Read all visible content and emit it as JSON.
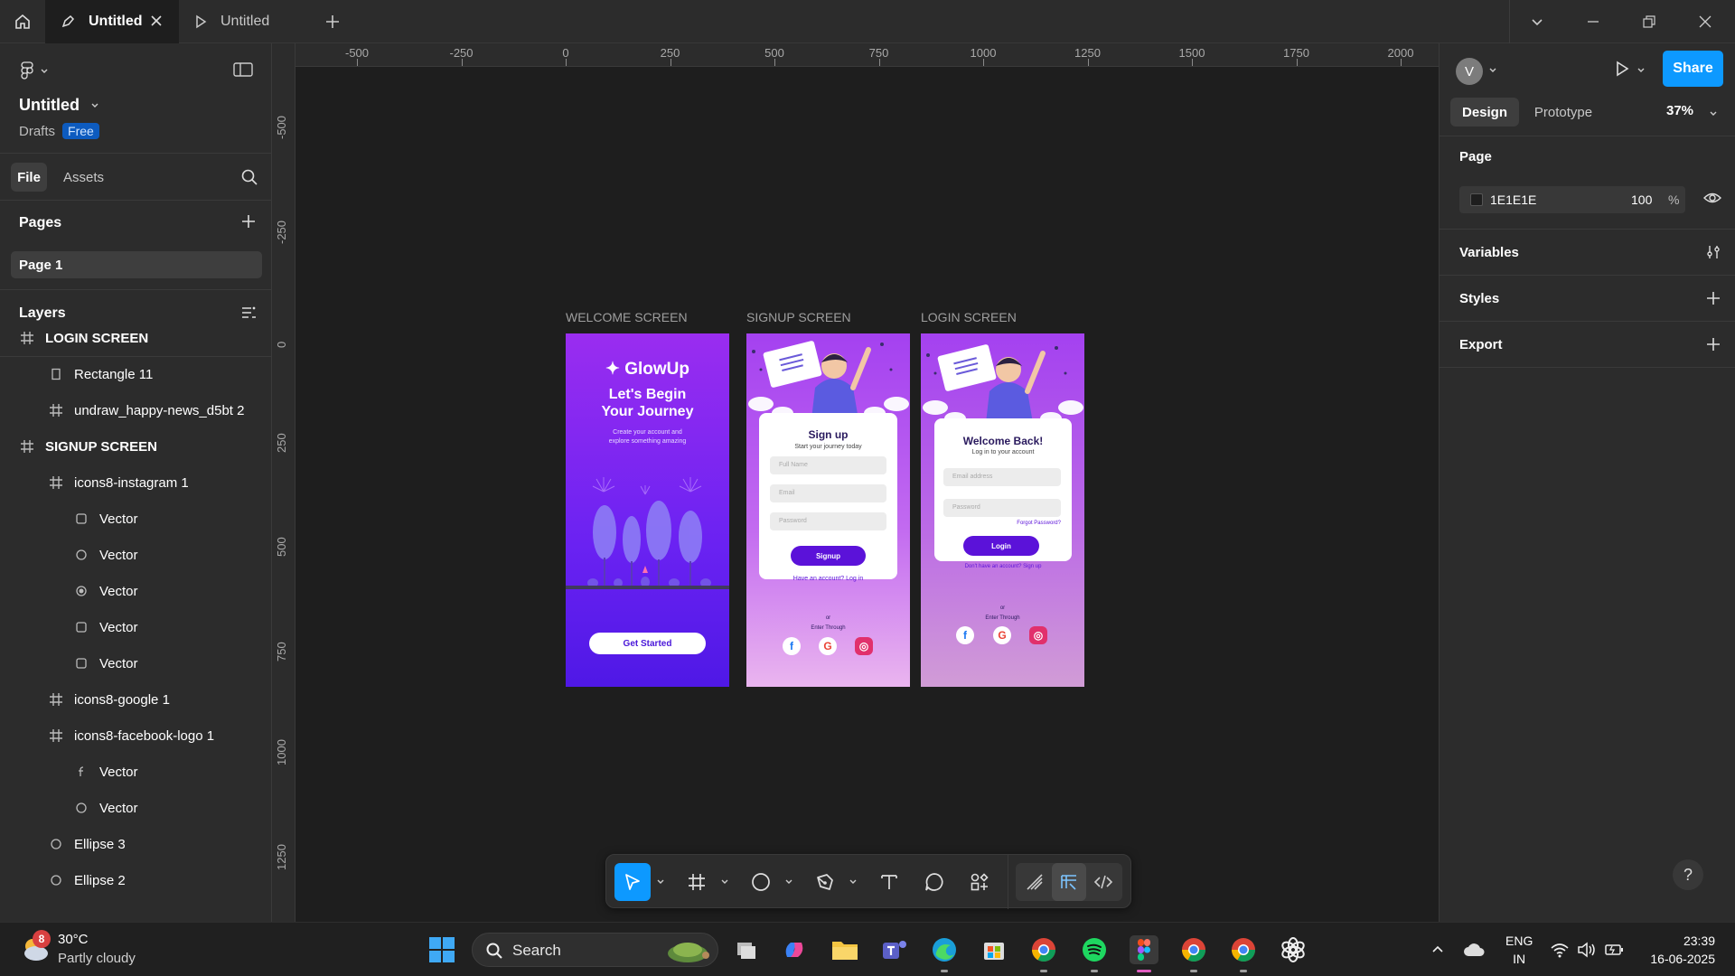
{
  "titlebar": {
    "tabs": [
      {
        "label": "Untitled",
        "kind": "design-file",
        "active": true
      },
      {
        "label": "Untitled",
        "kind": "prototype",
        "active": false
      }
    ]
  },
  "left_panel": {
    "file_title": "Untitled",
    "drafts_label": "Drafts",
    "plan_badge": "Free",
    "tabs": [
      "File",
      "Assets"
    ],
    "pages_heading": "Pages",
    "pages": [
      "Page 1"
    ],
    "layers_heading": "Layers",
    "layers": [
      {
        "name": "LOGIN SCREEN",
        "icon": "frame-icon",
        "level": 0
      },
      {
        "name": "Rectangle 11",
        "icon": "rectangle-icon",
        "level": 1
      },
      {
        "name": "undraw_happy-news_d5bt 2",
        "icon": "frame-icon",
        "level": 1
      },
      {
        "name": "SIGNUP SCREEN",
        "icon": "frame-icon",
        "level": 0
      },
      {
        "name": "icons8-instagram 1",
        "icon": "frame-icon",
        "level": 1
      },
      {
        "name": "Vector",
        "icon": "vector-square-icon",
        "level": 2
      },
      {
        "name": "Vector",
        "icon": "vector-circle-icon",
        "level": 2
      },
      {
        "name": "Vector",
        "icon": "vector-dot-icon",
        "level": 2
      },
      {
        "name": "Vector",
        "icon": "vector-square-icon",
        "level": 2
      },
      {
        "name": "Vector",
        "icon": "vector-square-icon",
        "level": 2
      },
      {
        "name": "icons8-google 1",
        "icon": "frame-icon",
        "level": 1
      },
      {
        "name": "icons8-facebook-logo 1",
        "icon": "frame-icon",
        "level": 1
      },
      {
        "name": "Vector",
        "icon": "vector-f-icon",
        "level": 2
      },
      {
        "name": "Vector",
        "icon": "vector-circle-icon",
        "level": 2
      },
      {
        "name": "Ellipse 3",
        "icon": "ellipse-icon",
        "level": 1
      },
      {
        "name": "Ellipse 2",
        "icon": "ellipse-icon",
        "level": 1
      }
    ]
  },
  "rulers": {
    "top": [
      "-500",
      "-250",
      "0",
      "250",
      "500",
      "750",
      "1000",
      "1250",
      "1500",
      "1750",
      "2000"
    ],
    "left": [
      "-500",
      "-250",
      "0",
      "250",
      "500",
      "750",
      "1000",
      "1250"
    ]
  },
  "canvas": {
    "welcome": {
      "label": "WELCOME SCREEN",
      "logo": "✦ GlowUp",
      "heading_line1": "Let's Begin",
      "heading_line2": "Your Journey",
      "subtext_line1": "Create your account and",
      "subtext_line2": "explore something amazing",
      "button": "Get Started"
    },
    "signup": {
      "label": "SIGNUP SCREEN",
      "title": "Sign up",
      "subtitle": "Start your journey today",
      "fields": [
        "Full Name",
        "Email",
        "Password"
      ],
      "button": "Signup",
      "link": "Have an account? Log in",
      "or_text": "or",
      "enter_through": "Enter Through"
    },
    "login": {
      "label": "LOGIN SCREEN",
      "title": "Welcome Back!",
      "subtitle": "Log in to your account",
      "fields": [
        "Email address",
        "Password"
      ],
      "forgot": "Forgot Password?",
      "button": "Login",
      "link": "Don't have an account? Sign up",
      "or_text": "or",
      "enter_through": "Enter Through"
    },
    "social_icons": [
      "facebook-icon",
      "google-icon",
      "instagram-icon"
    ]
  },
  "right_panel": {
    "avatar_initial": "V",
    "share_label": "Share",
    "tabs": [
      "Design",
      "Prototype"
    ],
    "zoom": "37%",
    "page_heading": "Page",
    "page_color_hex": "1E1E1E",
    "page_opacity": "100",
    "percent_sign": "%",
    "sections": [
      "Variables",
      "Styles",
      "Export"
    ],
    "help": "?"
  },
  "toolbar": {
    "tools": [
      "move-tool",
      "frame-tool",
      "shape-tool",
      "pen-tool",
      "text-tool",
      "comment-tool",
      "actions-tool"
    ],
    "dev_tools": [
      "draw-mode",
      "design-mode",
      "dev-mode"
    ]
  },
  "taskbar": {
    "weather_temp": "30°C",
    "weather_desc": "Partly cloudy",
    "weather_badge": "8",
    "search_label": "Search",
    "lang_line1": "ENG",
    "lang_line2": "IN",
    "time": "23:39",
    "date": "16-06-2025"
  },
  "colors": {
    "accent": "#0d99ff",
    "panel": "#2c2c2c",
    "canvas": "#1e1e1e"
  }
}
